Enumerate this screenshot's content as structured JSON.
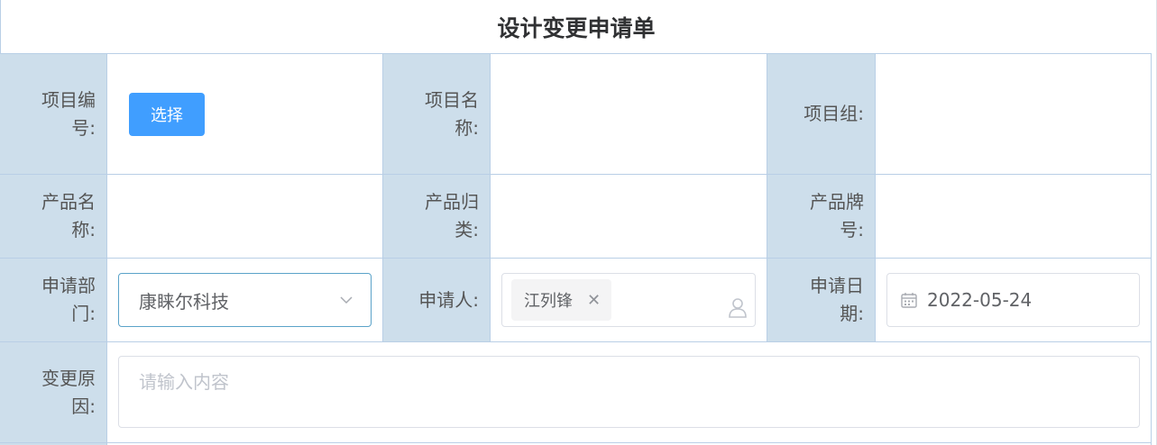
{
  "form": {
    "title": "设计变更申请单",
    "project_no_label": [
      "项目编",
      "号:"
    ],
    "select_button": "选择",
    "project_name_label": [
      "项目名",
      "称:"
    ],
    "project_group_label": "项目组:",
    "product_name_label": [
      "产品名",
      "称:"
    ],
    "product_category_label": [
      "产品归",
      "类:"
    ],
    "product_brand_label": [
      "产品牌",
      "号:"
    ],
    "dept_label": [
      "申请部",
      "门:"
    ],
    "dept_value": "康睐尔科技",
    "applicant_label": "申请人:",
    "applicant_tag": "江列锋",
    "date_label": [
      "申请日",
      "期:"
    ],
    "date_value": "2022-05-24",
    "reason_label": [
      "变更原",
      "因:"
    ],
    "reason_placeholder": "请输入内容"
  },
  "icons": {
    "dropdown": "chevron-down-icon",
    "tag_close": "close-icon",
    "user": "user-icon",
    "calendar": "calendar-icon"
  },
  "colors": {
    "label_bg": "#cddeeb",
    "border": "#b9cfe6",
    "primary": "#409eff",
    "select_border": "#5ba3c9"
  }
}
